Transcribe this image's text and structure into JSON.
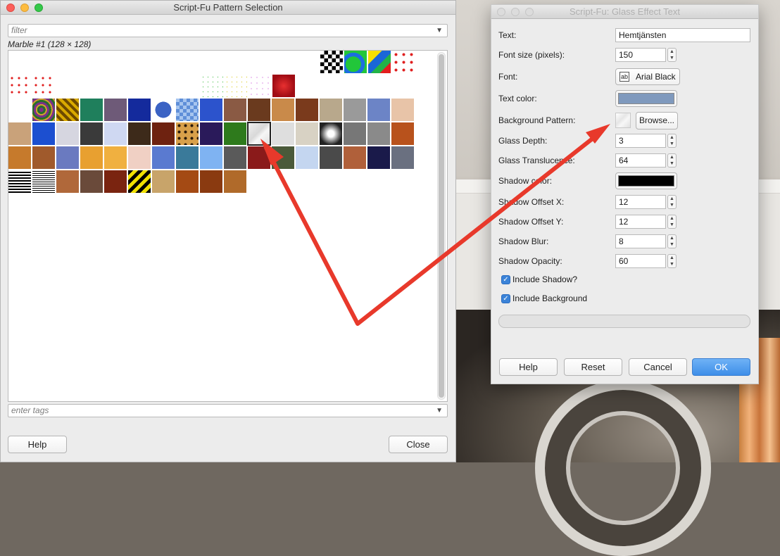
{
  "pattern_window": {
    "title": "Script-Fu Pattern Selection",
    "filter_placeholder": "filter",
    "selected_pattern_label": "Marble #1 (128 × 128)",
    "tags_placeholder": "enter tags",
    "help_label": "Help",
    "close_label": "Close"
  },
  "glass_dialog": {
    "title": "Script-Fu: Glass Effect Text",
    "text_label": "Text:",
    "text_value": "Hemtjänsten",
    "font_size_label": "Font size (pixels):",
    "font_size_value": "150",
    "font_label": "Font:",
    "font_value": "Arial Black",
    "text_color_label": "Text color:",
    "text_color": "#7f99bd",
    "bg_pattern_label": "Background Pattern:",
    "browse_label": "Browse...",
    "glass_depth_label": "Glass Depth:",
    "glass_depth_value": "3",
    "glass_transl_label": "Glass Translucence:",
    "glass_transl_value": "64",
    "shadow_color_label": "Shadow color:",
    "shadow_color": "#000000",
    "shadow_x_label": "Shadow Offset X:",
    "shadow_x_value": "12",
    "shadow_y_label": "Shadow Offset Y:",
    "shadow_y_value": "12",
    "shadow_blur_label": "Shadow Blur:",
    "shadow_blur_value": "8",
    "shadow_opacity_label": "Shadow Opacity:",
    "shadow_opacity_value": "60",
    "include_shadow_label": "Include Shadow?",
    "include_bg_label": "Include Background",
    "help_label": "Help",
    "reset_label": "Reset",
    "cancel_label": "Cancel",
    "ok_label": "OK"
  },
  "annotation_color": "#e8392b"
}
